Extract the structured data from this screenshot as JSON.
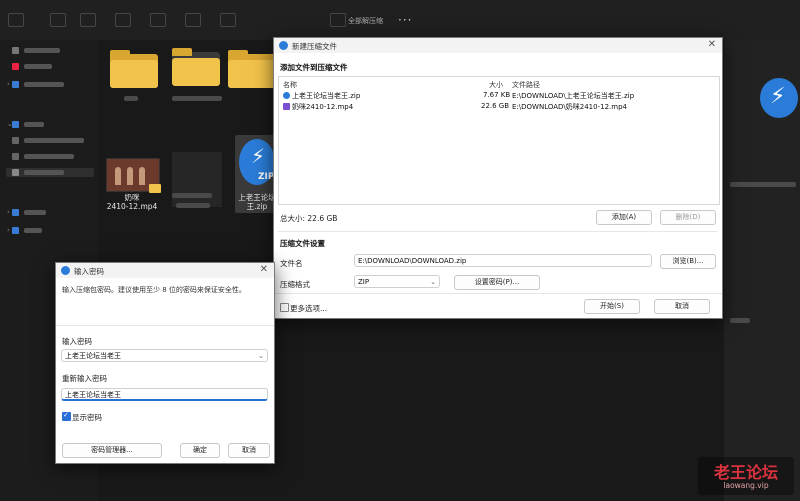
{
  "explorer": {
    "toolbar_extract_label": "全部解压缩",
    "more_label": "···",
    "files": [
      {
        "label": "奶咪\n2410-12.mp4"
      },
      {
        "label": "上老王论坛\n王.zip"
      }
    ]
  },
  "compress_dialog": {
    "title": "新建压缩文件",
    "section_add": "添加文件到压缩文件",
    "columns": {
      "name": "名称",
      "size": "大小",
      "path": "文件路径"
    },
    "rows": [
      {
        "name": "上老王论坛当老王.zip",
        "size": "7.67 KB",
        "path": "E:\\DOWNLOAD\\上老王论坛当老王.zip"
      },
      {
        "name": "奶咪2410-12.mp4",
        "size": "22.6 GB",
        "path": "E:\\DOWNLOAD\\奶咪2410-12.mp4"
      }
    ],
    "total_size": "总大小: 22.6 GB",
    "add_button": "添加(A)",
    "delete_button": "删除(D)",
    "section_settings": "压缩文件设置",
    "filename_label": "文件名",
    "filename_value": "E:\\DOWNLOAD\\DOWNLOAD.zip",
    "browse_button": "浏览(B)...",
    "format_label": "压缩格式",
    "format_value": "ZIP",
    "set_password_button": "设置密码(P)...",
    "more_options": "更多选项...",
    "start_button": "开始(S)",
    "cancel_button": "取消"
  },
  "password_dialog": {
    "title": "输入密码",
    "description": "输入压缩包密码。建议使用至少 8 位的密码来保证安全性。",
    "enter_label": "输入密码",
    "enter_value": "上老王论坛当老王",
    "reenter_label": "重新输入密码",
    "reenter_value": "上老王论坛当老王",
    "show_password": "显示密码",
    "manager_button": "密码管理器...",
    "ok_button": "确定",
    "cancel_button": "取消"
  },
  "watermark": {
    "main": "老王论坛",
    "sub": "laowang.vip"
  },
  "colors": {
    "accent": "#2a6fd6",
    "folder": "#f2c34a",
    "zip_icon": "#2a7cd8"
  }
}
